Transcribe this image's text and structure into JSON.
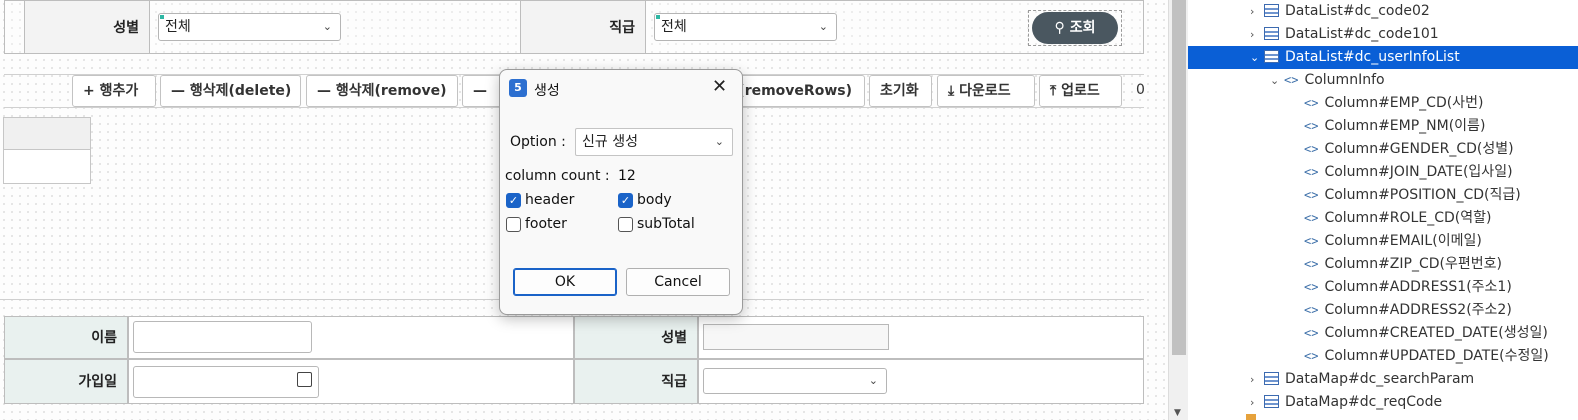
{
  "search": {
    "gender_label": "성별",
    "gender_value": "전체",
    "position_label": "직급",
    "position_value": "전체",
    "search_button": "조회"
  },
  "toolbar": {
    "add_row": "행추가",
    "delete_row": "행삭제(delete)",
    "remove_row": "행삭제(remove)",
    "remove_rows_partial": "l(removeRows)",
    "init": "초기화",
    "download": "다운로드",
    "upload": "업로드",
    "count": "0"
  },
  "form": {
    "name_label": "이름",
    "gender_label": "성별",
    "join_label": "가입일",
    "position_label": "직급"
  },
  "dialog": {
    "title": "생성",
    "option_label": "Option :",
    "option_value": "신규 생성",
    "column_count_label": "column count :",
    "column_count": "12",
    "header": "header",
    "body": "body",
    "footer": "footer",
    "subtotal": "subTotal",
    "ok": "OK",
    "cancel": "Cancel"
  },
  "tree": {
    "items": [
      {
        "label": "DataList#dc_code02"
      },
      {
        "label": "DataList#dc_code101"
      },
      {
        "label": "DataList#dc_userInfoList"
      },
      {
        "label": "ColumnInfo"
      },
      {
        "label": "Column#EMP_CD(사번)"
      },
      {
        "label": "Column#EMP_NM(이름)"
      },
      {
        "label": "Column#GENDER_CD(성별)"
      },
      {
        "label": "Column#JOIN_DATE(입사일)"
      },
      {
        "label": "Column#POSITION_CD(직급)"
      },
      {
        "label": "Column#ROLE_CD(역할)"
      },
      {
        "label": "Column#EMAIL(이메일)"
      },
      {
        "label": "Column#ZIP_CD(우편번호)"
      },
      {
        "label": "Column#ADDRESS1(주소1)"
      },
      {
        "label": "Column#ADDRESS2(주소2)"
      },
      {
        "label": "Column#CREATED_DATE(생성일)"
      },
      {
        "label": "Column#UPDATED_DATE(수정일)"
      },
      {
        "label": "DataMap#dc_searchParam"
      },
      {
        "label": "DataMap#dc_reqCode"
      }
    ]
  },
  "colors": {
    "selection": "#0a5fd6",
    "search_button": "#4a5760",
    "checkbox": "#1a63c8"
  }
}
